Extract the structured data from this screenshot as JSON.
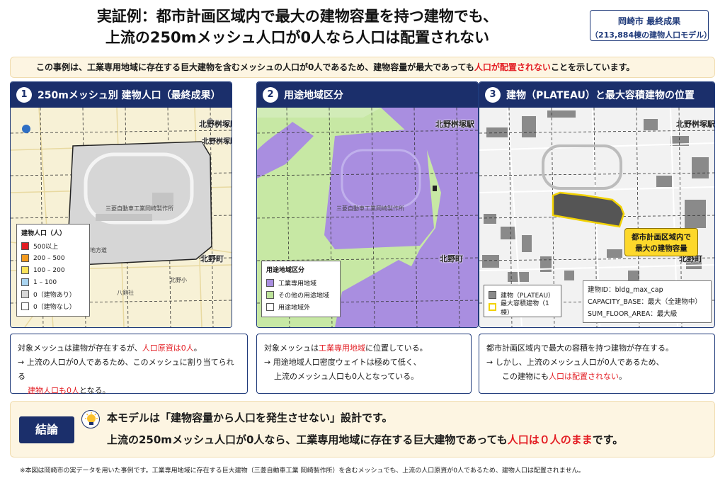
{
  "header": {
    "title_line1": "実証例：都市計画区域内で最大の建物容量を持つ建物でも、",
    "title_line2": "上流の250mメッシュ人口が0人なら人口は配置されない",
    "badge_line1": "岡崎市 最終成果",
    "badge_line2": "（213,884棟の建物人口モデル）"
  },
  "note": {
    "pre": "この事例は、工業専用地域に存在する巨大建物を含むメッシュの人口が0人であるため、建物容量が最大であっても",
    "highlight": "人口が配置されない",
    "post": "ことを示しています。"
  },
  "panels": [
    {
      "num": "1",
      "title": "250mメッシュ別 建物人口（最終成果）",
      "labels": {
        "station1": "北野桝塚駅",
        "station2": "北野桝塚駅",
        "town": "北野町",
        "factory": "三菱自動車工業岡崎製作所",
        "school": "北野小",
        "shrine": "八剣社",
        "route": "主要地方道"
      },
      "legend": {
        "title": "建物人口（人）",
        "items": [
          {
            "label": "500以上",
            "color": "#e31e24"
          },
          {
            "label": "200 – 500",
            "color": "#f39a1e"
          },
          {
            "label": "100 – 200",
            "color": "#fbe35a"
          },
          {
            "label": "1 – 100",
            "color": "#a9d4f0"
          },
          {
            "label": "0（建物あり）",
            "color": "#d8d8d8"
          },
          {
            "label": "0（建物なし）",
            "color": "#ffffff"
          }
        ]
      }
    },
    {
      "num": "2",
      "title": "用途地域区分",
      "labels": {
        "station": "北野桝塚駅",
        "town": "北野町",
        "factory": "三菱自動車工業岡崎製作所"
      },
      "legend": {
        "title": "用途地域区分",
        "items": [
          {
            "label": "工業専用地域",
            "color": "#a98ee0"
          },
          {
            "label": "その他の用途地域",
            "color": "#bde39a"
          },
          {
            "label": "用途地域外",
            "color": "#ffffff"
          }
        ]
      }
    },
    {
      "num": "3",
      "title": "建物（PLATEAU）と最大容積建物の位置",
      "labels": {
        "station": "北野桝塚駅",
        "town": "北野町"
      },
      "callout": {
        "line1": "都市計画区域内で",
        "line2": "最大の建物容量"
      },
      "legend": {
        "items": [
          {
            "label": "建物（PLATEAU）",
            "color": "#8a8a8a"
          },
          {
            "label": "最大容積建物（1棟）",
            "color": "#ffffff",
            "border": "#f2d200"
          }
        ]
      },
      "info": {
        "line1": "建物ID：bldg_max_cap",
        "line2": "CAPACITY_BASE：最大（全建物中）",
        "line3": "SUM_FLOOR_AREA：最大級"
      }
    }
  ],
  "descriptions": [
    {
      "l1_pre": "対象メッシュは建物が存在するが、",
      "l1_red": "人口原資は0人",
      "l1_post": "。",
      "l2": "→ 上流の人口が0人であるため、このメッシュに割り当てられる",
      "l3_red": "建物人口も0人",
      "l3_post": "となる。"
    },
    {
      "l1_pre": "対象メッシュは",
      "l1_red": "工業専用地域",
      "l1_post": "に位置している。",
      "l2": "→ 用途地域人口密度ウェイトは極めて低く、",
      "l3": "上流のメッシュ人口も0人となっている。"
    },
    {
      "l1": "都市計画区域内で最大の容積を持つ建物が存在する。",
      "l2": "→ しかし、上流のメッシュ人口が0人であるため、",
      "l3_pre": "この建物にも",
      "l3_red": "人口は配置されない",
      "l3_post": "。"
    }
  ],
  "conclusion": {
    "tag": "結論",
    "line1": "本モデルは「建物容量から人口を発生させない」設計です。",
    "line2_pre": "上流の250mメッシュ人口が0人なら、工業専用地域に存在する巨大建物であっても",
    "line2_red": "人口は０人のまま",
    "line2_post": "です。"
  },
  "footnote": "※本図は岡崎市の実データを用いた事例です。工業専用地域に存在する巨大建物（三菱自動車工業 岡崎製作所）を含むメッシュでも、上流の人口原資が0人であるため、建物人口は配置されません。"
}
